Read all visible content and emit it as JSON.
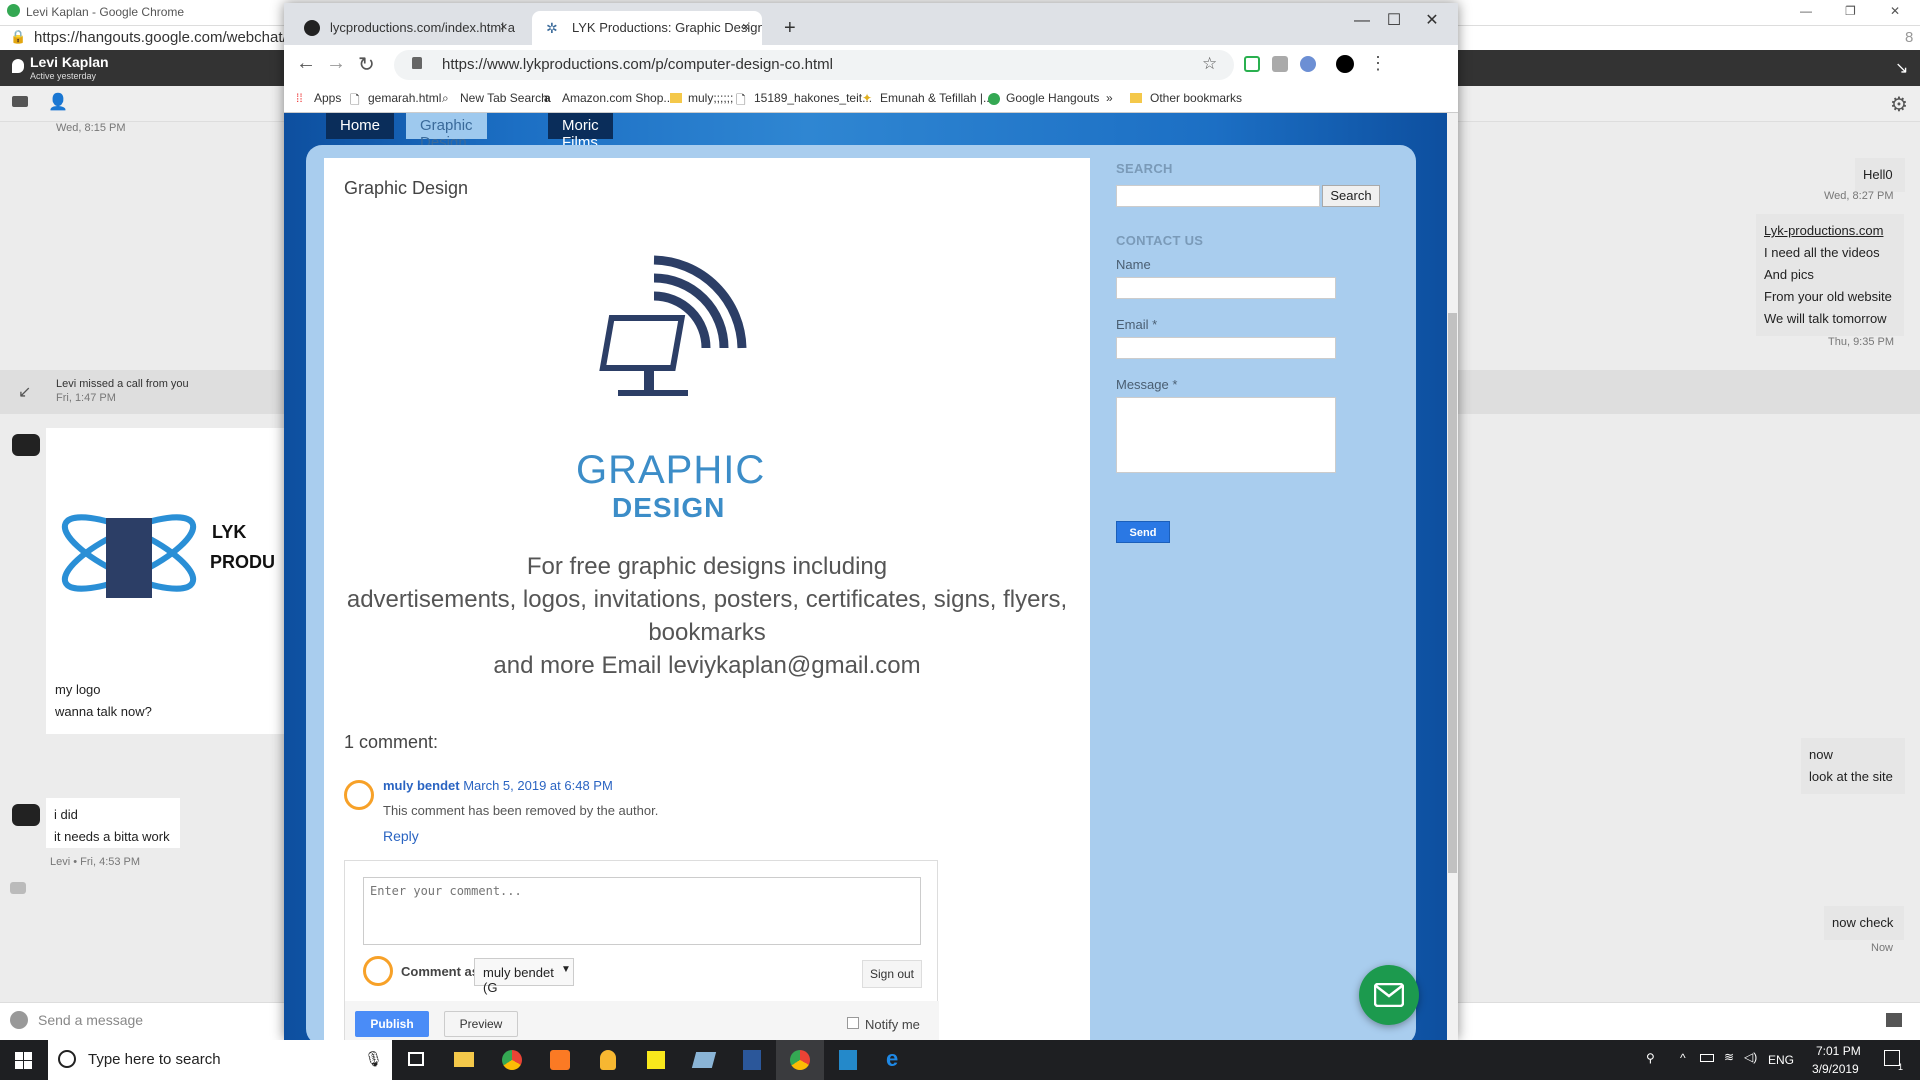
{
  "background_window": {
    "title": "Levi Kaplan - Google Chrome",
    "url": "https://hangouts.google.com/webchat/u",
    "url_fragment": "8",
    "contact_name": "Levi Kaplan",
    "contact_status": "Active yesterday",
    "missed_call": "Levi missed a call from you",
    "missed_call_time": "Fri, 1:47 PM",
    "top_time": "Wed, 8:15 PM",
    "logo_caption_1": "my logo",
    "logo_caption_2": "wanna talk now?",
    "logo_text_1": "LYK",
    "logo_text_2": "PRODU",
    "msg_i_did": "i did",
    "msg_bitta_work": "it needs a bitta work",
    "msg_meta_levi": "Levi • Fri, 4:53 PM",
    "right_msg_hello": "Hell0",
    "right_time_1": "Wed, 8:27 PM",
    "right_link": "Lyk-productions.com",
    "right_lines": [
      "I need all the videos",
      "And pics",
      "From your old website",
      "We will talk tomorrow"
    ],
    "right_time_2": "Thu, 9:35 PM",
    "right_now": "now",
    "right_look": "look at the site",
    "right_now_check": "now check",
    "right_time_now": "Now",
    "send_placeholder": "Send a message"
  },
  "chrome": {
    "tabs": [
      {
        "label": "lycproductions.com/index.html a"
      },
      {
        "label": "LYK Productions: Graphic Design"
      }
    ],
    "new_tab": "+",
    "url": "https://www.lykproductions.com/p/computer-design-co.html",
    "bookmarks": [
      "Apps",
      "gemarah.html",
      "New Tab Search",
      "Amazon.com Shop...",
      "muly;;;;;;",
      "15189_hakones_teit...",
      "Emunah & Tefillah |...",
      "Google Hangouts",
      "»",
      "Other bookmarks"
    ]
  },
  "page": {
    "nav": [
      "Home",
      "Graphic Design",
      "Moric Films"
    ],
    "post_title": "Graphic Design",
    "logo_text_1": "GRAPHIC",
    "logo_text_2": "DESIGN",
    "body_lines": [
      "For free graphic designs including",
      "advertisements, logos, invitations, posters, certificates, signs, flyers,",
      "bookmarks",
      "and more Email leviykaplan@gmail.com"
    ],
    "comments_title": "1 comment:",
    "commenter": "muly bendet",
    "comment_date": "March 5, 2019 at 6:48 PM",
    "comment_body": "This comment has been removed by the author.",
    "reply": "Reply",
    "comment_placeholder": "Enter your comment...",
    "comment_as": "Comment as:",
    "identity": "muly bendet (G",
    "sign_out": "Sign out",
    "publish": "Publish",
    "preview": "Preview",
    "notify": "Notify me"
  },
  "sidebar": {
    "search_heading": "SEARCH",
    "search_button": "Search",
    "contact_heading": "CONTACT US",
    "name_label": "Name",
    "email_label": "Email *",
    "message_label": "Message *",
    "send_button": "Send"
  },
  "taskbar": {
    "search_placeholder": "Type here to search",
    "lang": "ENG",
    "time": "7:01 PM",
    "date": "3/9/2019",
    "notif_count": "1"
  }
}
